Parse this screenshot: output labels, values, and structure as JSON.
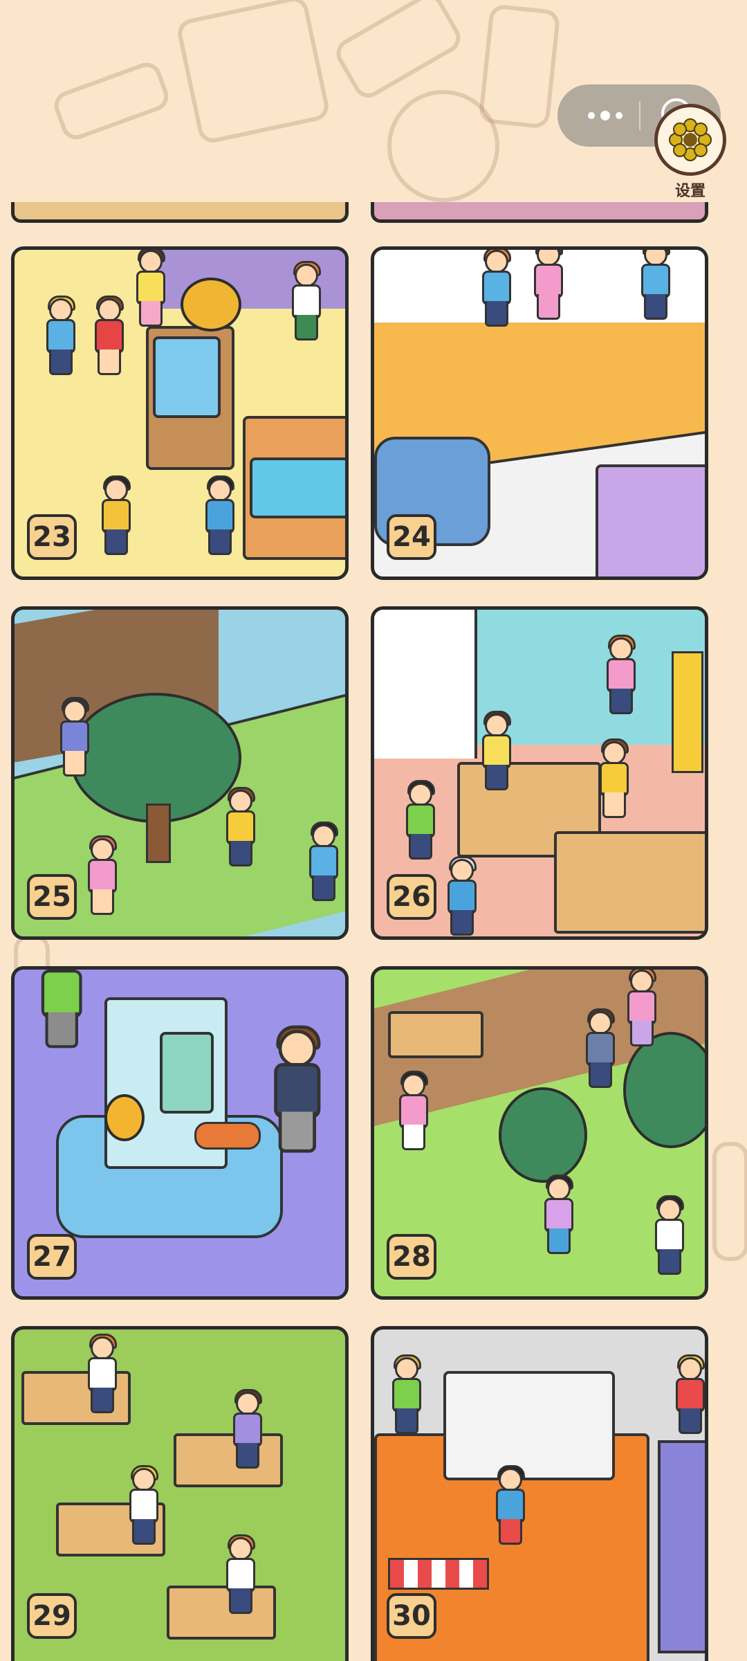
{
  "header": {
    "capsule_menu_icon": "more-dots-icon",
    "capsule_close_icon": "target-icon",
    "settings_icon": "flower-gear-icon",
    "settings_label": "设置"
  },
  "levels": [
    {
      "number": "23",
      "scene": "game-hall"
    },
    {
      "number": "24",
      "scene": "shop-roof"
    },
    {
      "number": "25",
      "scene": "park-tree"
    },
    {
      "number": "26",
      "scene": "craft-room"
    },
    {
      "number": "27",
      "scene": "vending-machine"
    },
    {
      "number": "28",
      "scene": "garden-playground"
    },
    {
      "number": "29",
      "scene": "exam-classroom"
    },
    {
      "number": "30",
      "scene": "toy-store"
    }
  ],
  "colors": {
    "background": "#fbe6cc",
    "badge": "#f8d08f",
    "frame": "#2a2a2a"
  }
}
